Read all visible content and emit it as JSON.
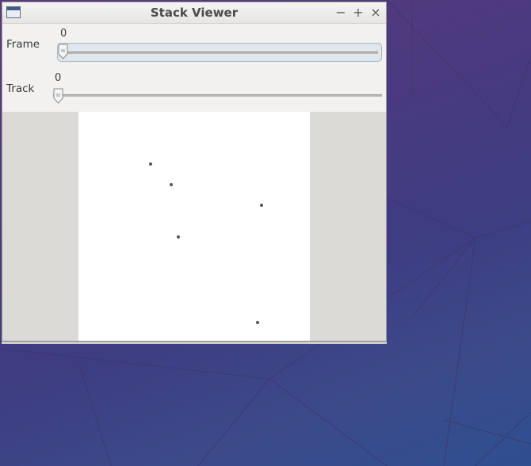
{
  "window": {
    "title": "Stack Viewer",
    "minimize_label": "−",
    "maximize_label": "+",
    "close_label": "×"
  },
  "frame": {
    "label": "Frame",
    "value": "0"
  },
  "track": {
    "label": "Track",
    "value": "0"
  },
  "canvas": {
    "points": [
      {
        "x": 0.31,
        "y": 0.225
      },
      {
        "x": 0.4,
        "y": 0.315
      },
      {
        "x": 0.79,
        "y": 0.405
      },
      {
        "x": 0.43,
        "y": 0.54
      },
      {
        "x": 0.775,
        "y": 0.91
      }
    ]
  },
  "colors": {
    "desktop_accent": "#4a3a80",
    "window_bg": "#f2f1f0",
    "canvas_bg": "#ffffff"
  }
}
